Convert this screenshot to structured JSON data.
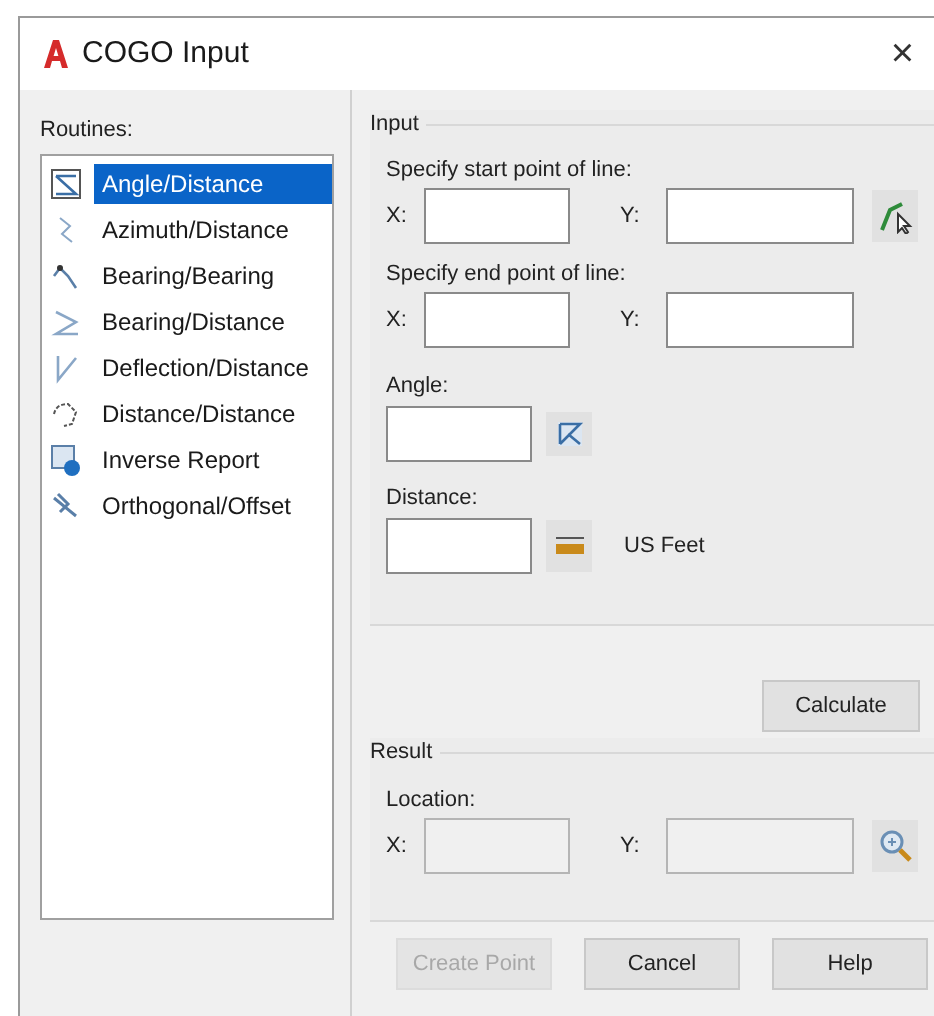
{
  "window": {
    "title": "COGO Input",
    "close": "×"
  },
  "routines": {
    "label": "Routines:",
    "items": [
      {
        "label": "Angle/Distance",
        "selected": true
      },
      {
        "label": "Azimuth/Distance",
        "selected": false
      },
      {
        "label": "Bearing/Bearing",
        "selected": false
      },
      {
        "label": "Bearing/Distance",
        "selected": false
      },
      {
        "label": "Deflection/Distance",
        "selected": false
      },
      {
        "label": "Distance/Distance",
        "selected": false
      },
      {
        "label": "Inverse Report",
        "selected": false
      },
      {
        "label": "Orthogonal/Offset",
        "selected": false
      }
    ]
  },
  "input": {
    "title": "Input",
    "start": {
      "label": "Specify start point of line:",
      "x_label": "X:",
      "y_label": "Y:"
    },
    "end": {
      "label": "Specify end point of line:",
      "x_label": "X:",
      "y_label": "Y:"
    },
    "angle": {
      "label": "Angle:"
    },
    "distance": {
      "label": "Distance:",
      "units": "US Feet"
    }
  },
  "calculate": "Calculate",
  "result": {
    "title": "Result",
    "location": {
      "label": "Location:",
      "x_label": "X:",
      "y_label": "Y:",
      "disabled": true
    }
  },
  "buttons": [
    {
      "label": "Create Point",
      "disabled": true
    },
    {
      "label": "Cancel",
      "disabled": false
    },
    {
      "label": "Help",
      "disabled": false
    }
  ]
}
